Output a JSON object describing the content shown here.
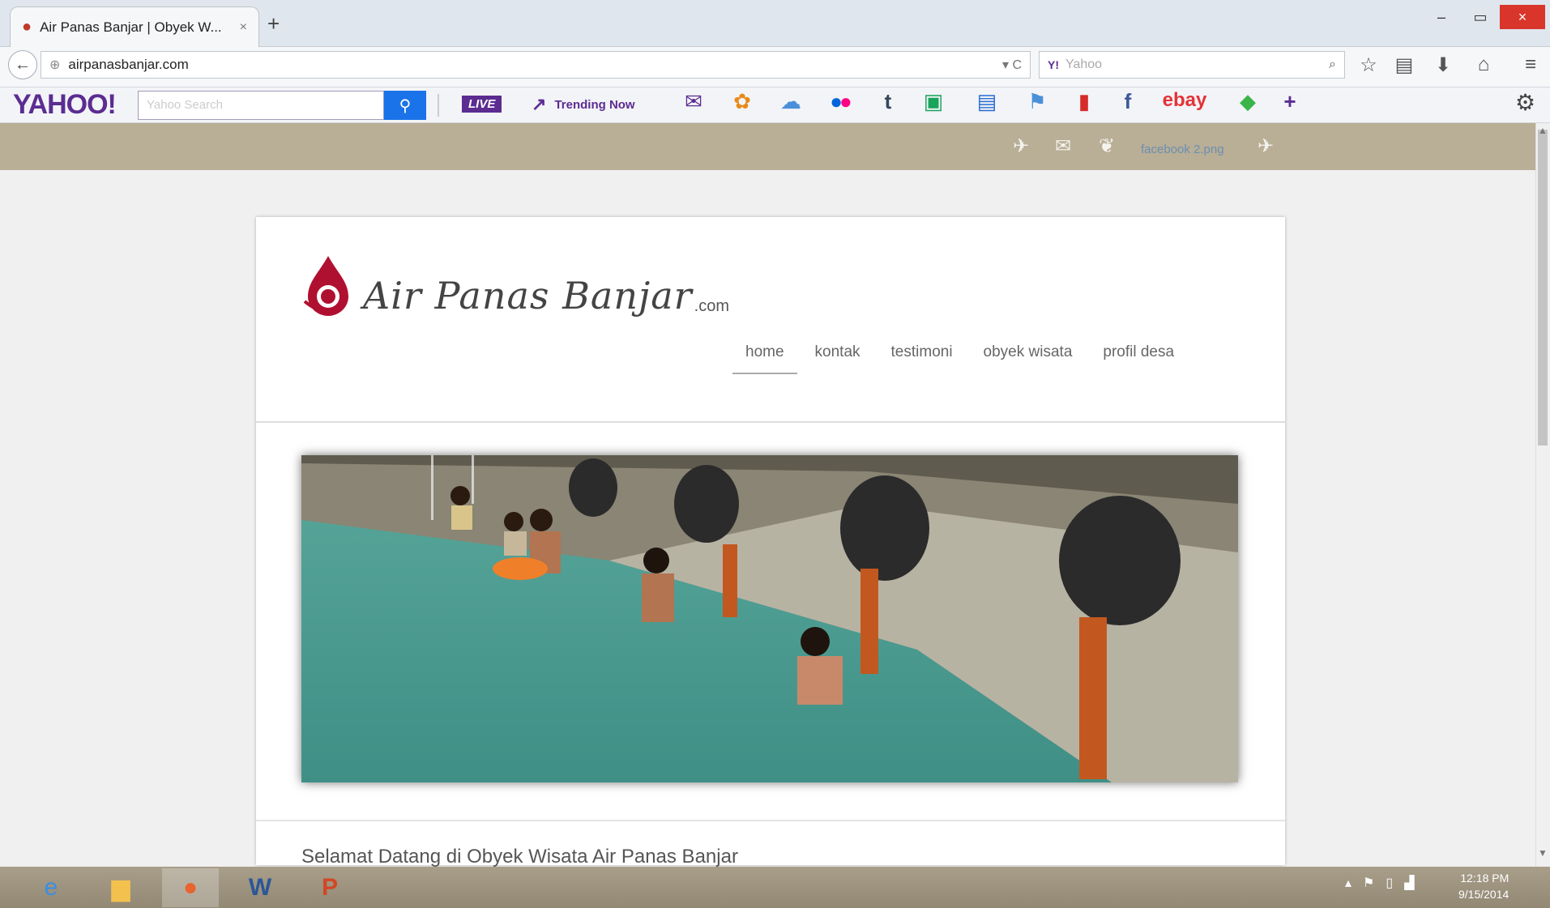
{
  "browser": {
    "tab_title": "Air Panas Banjar | Obyek W...",
    "tab_close": "×",
    "new_tab": "+",
    "window_controls": [
      "–",
      "▭",
      "×"
    ],
    "url": "airpanasbanjar.com",
    "url_icons": "▾ C",
    "search_placeholder": "Yahoo",
    "search_engine_icon": "Y!",
    "nav_icons": [
      "star-icon",
      "clipboard-icon",
      "download-icon",
      "home-icon",
      "menu-icon"
    ]
  },
  "yahoo_toolbar": {
    "logo": "YAHOO!",
    "search_placeholder": "Yahoo Search",
    "live_label": "LIVE",
    "trending_label": "Trending Now",
    "icons": [
      "mail-icon",
      "flower-icon",
      "weather-icon",
      "flickr-icon",
      "tumblr-icon",
      "answers-icon",
      "news-icon",
      "sports-icon",
      "bookmark-icon",
      "facebook-icon",
      "ebay-icon",
      "tag-icon",
      "add-icon"
    ],
    "ebay_label": "ebay",
    "tumblr_label": "t",
    "facebook_label": "f"
  },
  "page_strip": {
    "facebook_link": "facebook 2.png"
  },
  "site": {
    "logo_text": "Air Panas Banjar",
    "logo_domain": ".com",
    "menu": [
      "home",
      "kontak",
      "testimoni",
      "obyek wisata",
      "profil desa"
    ],
    "welcome_heading": "Selamat Datang di Obyek Wisata Air Panas Banjar"
  },
  "taskbar": {
    "apps": [
      "ie-icon",
      "explorer-icon",
      "firefox-icon",
      "word-icon",
      "powerpoint-icon"
    ],
    "time": "12:18 PM",
    "date": "9/15/2014"
  },
  "colors": {
    "yahoo_purple": "#5c2c91",
    "strip": "#b9ae96",
    "close_red": "#d9352b"
  }
}
